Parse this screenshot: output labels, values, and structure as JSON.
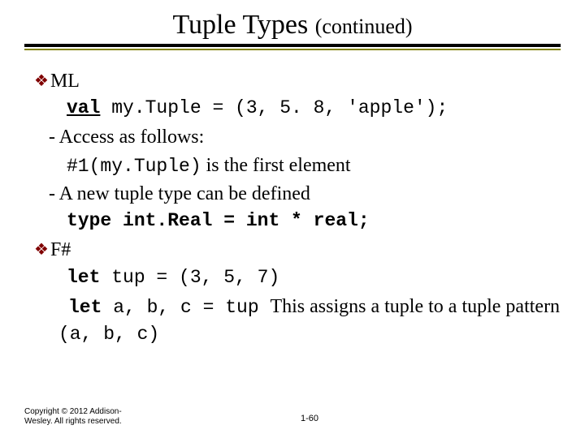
{
  "title_main": "Tuple Types ",
  "title_cont": "(continued)",
  "b1_label": "ML",
  "code1_pre": "val",
  "code1_rest": " my.Tuple = (3, 5. 8, 'apple');",
  "sub1": "- Access as follows:",
  "code2": "#1(my.Tuple)",
  "code2_tail": " is the first element",
  "sub2": "- A new tuple type can be defined",
  "code3": "type int.Real = int * real;",
  "b2_label": "F#",
  "code4": "let",
  "code4_rest": " tup = (3, 5, 7)",
  "code5": "let",
  "code5_rest": " a, b, c = tup ",
  "tail5": "  This assigns a tuple to a tuple pattern ",
  "code6": "(a, b, c)",
  "footer": "Copyright © 2012 Addison-Wesley. All rights reserved.",
  "slidenum": "1-60"
}
